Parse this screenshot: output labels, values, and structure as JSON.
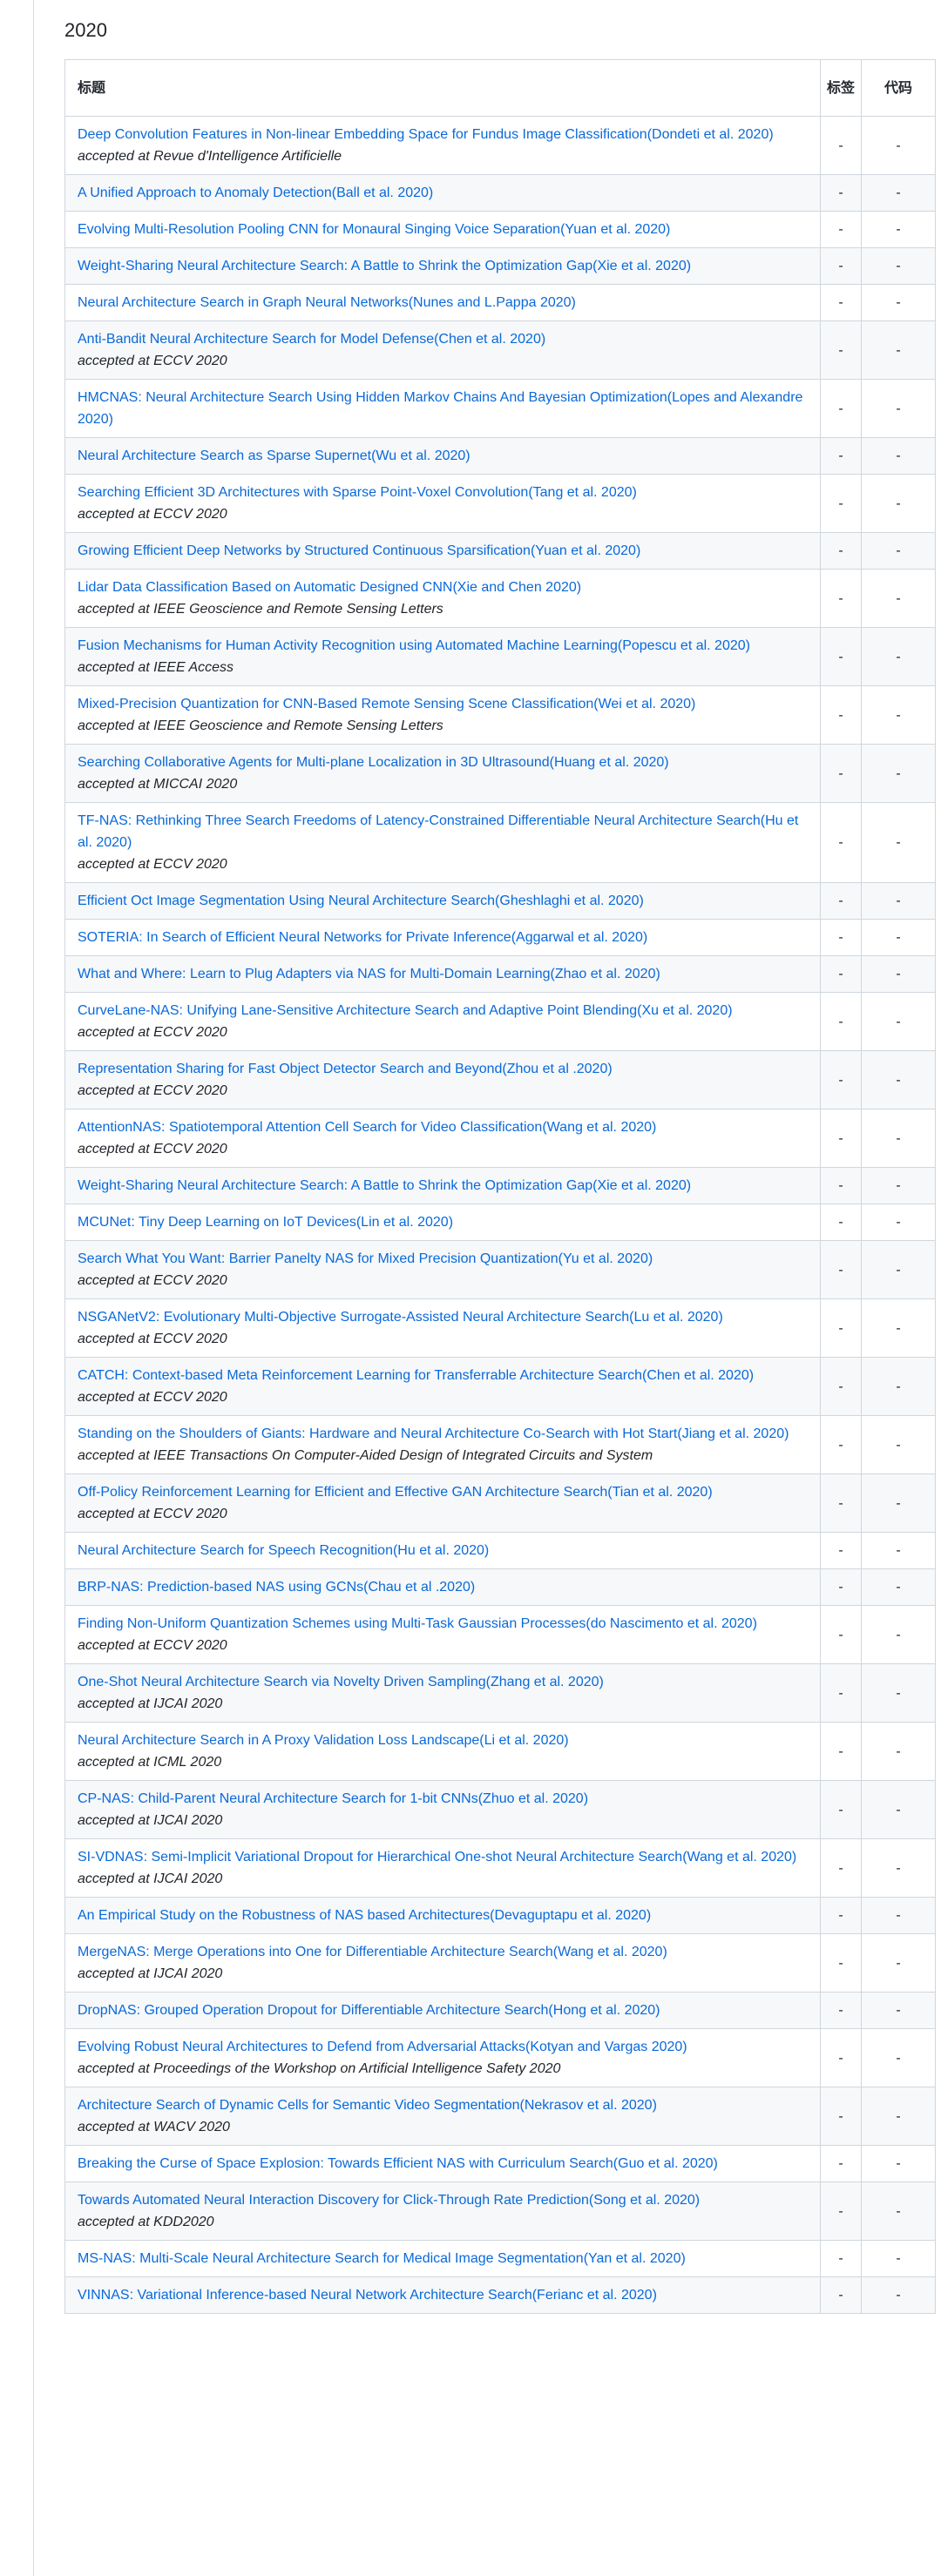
{
  "section": {
    "heading": "2020"
  },
  "table": {
    "headers": {
      "title": "标题",
      "tags": "标签",
      "code": "代码"
    },
    "rows": [
      {
        "title": "Deep Convolution Features in Non-linear Embedding Space for Fundus Image Classification(Dondeti et al. 2020)",
        "note": "accepted at Revue d'Intelligence Artificielle",
        "tags": "-",
        "code": "-"
      },
      {
        "title": "A Unified Approach to Anomaly Detection(Ball et al. 2020)",
        "note": "",
        "tags": "-",
        "code": "-"
      },
      {
        "title": "Evolving Multi-Resolution Pooling CNN for Monaural Singing Voice Separation(Yuan et al. 2020)",
        "note": "",
        "tags": "-",
        "code": "-"
      },
      {
        "title": "Weight-Sharing Neural Architecture Search: A Battle to Shrink the Optimization Gap(Xie et al. 2020)",
        "note": "",
        "tags": "-",
        "code": "-"
      },
      {
        "title": "Neural Architecture Search in Graph Neural Networks(Nunes and L.Pappa 2020)",
        "note": "",
        "tags": "-",
        "code": "-"
      },
      {
        "title": "Anti-Bandit Neural Architecture Search for Model Defense(Chen et al. 2020)",
        "note": "accepted at ECCV 2020",
        "tags": "-",
        "code": "-"
      },
      {
        "title": "HMCNAS: Neural Architecture Search Using Hidden Markov Chains And Bayesian Optimization(Lopes and Alexandre 2020)",
        "note": "",
        "tags": "-",
        "code": "-"
      },
      {
        "title": "Neural Architecture Search as Sparse Supernet(Wu et al. 2020)",
        "note": "",
        "tags": "-",
        "code": "-"
      },
      {
        "title": "Searching Efficient 3D Architectures with Sparse Point-Voxel Convolution(Tang et al. 2020)",
        "note": "accepted at ECCV 2020",
        "tags": "-",
        "code": "-"
      },
      {
        "title": "Growing Efficient Deep Networks by Structured Continuous Sparsification(Yuan et al. 2020)",
        "note": "",
        "tags": "-",
        "code": "-"
      },
      {
        "title": "Lidar Data Classification Based on Automatic Designed CNN(Xie and Chen 2020)",
        "note": "accepted at IEEE Geoscience and Remote Sensing Letters",
        "tags": "-",
        "code": "-"
      },
      {
        "title": "Fusion Mechanisms for Human Activity Recognition using Automated Machine Learning(Popescu et al. 2020)",
        "note": "accepted at IEEE Access",
        "tags": "-",
        "code": "-"
      },
      {
        "title": "Mixed-Precision Quantization for CNN-Based Remote Sensing Scene Classification(Wei et al. 2020)",
        "note": "accepted at IEEE Geoscience and Remote Sensing Letters",
        "tags": "-",
        "code": "-"
      },
      {
        "title": "Searching Collaborative Agents for Multi-plane Localization in 3D Ultrasound(Huang et al. 2020)",
        "note": "accepted at MICCAI 2020",
        "tags": "-",
        "code": "-"
      },
      {
        "title": "TF-NAS: Rethinking Three Search Freedoms of Latency-Constrained Differentiable Neural Architecture Search(Hu et al. 2020)",
        "note": "accepted at ECCV 2020",
        "tags": "-",
        "code": "-"
      },
      {
        "title": "Efficient Oct Image Segmentation Using Neural Architecture Search(Gheshlaghi et al. 2020)",
        "note": "",
        "tags": "-",
        "code": "-"
      },
      {
        "title": "SOTERIA: In Search of Efficient Neural Networks for Private Inference(Aggarwal et al. 2020)",
        "note": "",
        "tags": "-",
        "code": "-"
      },
      {
        "title": "What and Where: Learn to Plug Adapters via NAS for Multi-Domain Learning(Zhao et al. 2020)",
        "note": "",
        "tags": "-",
        "code": "-"
      },
      {
        "title": "CurveLane-NAS: Unifying Lane-Sensitive Architecture Search and Adaptive Point Blending(Xu et al. 2020)",
        "note": "accepted at ECCV 2020",
        "tags": "-",
        "code": "-"
      },
      {
        "title": "Representation Sharing for Fast Object Detector Search and Beyond(Zhou et al .2020)",
        "note": "accepted at ECCV 2020",
        "tags": "-",
        "code": "-"
      },
      {
        "title": "AttentionNAS: Spatiotemporal Attention Cell Search for Video Classification(Wang et al. 2020)",
        "note": "accepted at ECCV 2020",
        "tags": "-",
        "code": "-"
      },
      {
        "title": "Weight-Sharing Neural Architecture Search: A Battle to Shrink the Optimization Gap(Xie et al. 2020)",
        "note": "",
        "tags": "-",
        "code": "-"
      },
      {
        "title": "MCUNet: Tiny Deep Learning on IoT Devices(Lin et al. 2020)",
        "note": "",
        "tags": "-",
        "code": "-"
      },
      {
        "title": "Search What You Want: Barrier Panelty NAS for Mixed Precision Quantization(Yu et al. 2020)",
        "note": "accepted at ECCV 2020",
        "tags": "-",
        "code": "-"
      },
      {
        "title": "NSGANetV2: Evolutionary Multi-Objective Surrogate-Assisted Neural Architecture Search(Lu et al. 2020)",
        "note": "accepted at ECCV 2020",
        "tags": "-",
        "code": "-"
      },
      {
        "title": "CATCH: Context-based Meta Reinforcement Learning for Transferrable Architecture Search(Chen et al. 2020)",
        "note": "accepted at ECCV 2020",
        "tags": "-",
        "code": "-"
      },
      {
        "title": "Standing on the Shoulders of Giants: Hardware and Neural Architecture Co-Search with Hot Start(Jiang et al. 2020)",
        "note": "accepted at IEEE Transactions On Computer-Aided Design of Integrated Circuits and System",
        "tags": "-",
        "code": "-"
      },
      {
        "title": "Off-Policy Reinforcement Learning for Efficient and Effective GAN Architecture Search(Tian et al. 2020)",
        "note": "accepted at ECCV 2020",
        "tags": "-",
        "code": "-"
      },
      {
        "title": "Neural Architecture Search for Speech Recognition(Hu et al. 2020)",
        "note": "",
        "tags": "-",
        "code": "-"
      },
      {
        "title": "BRP-NAS: Prediction-based NAS using GCNs(Chau et al .2020)",
        "note": "",
        "tags": "-",
        "code": "-"
      },
      {
        "title": "Finding Non-Uniform Quantization Schemes using Multi-Task Gaussian Processes(do Nascimento et al. 2020)",
        "note": "accepted at ECCV 2020",
        "tags": "-",
        "code": "-"
      },
      {
        "title": "One-Shot Neural Architecture Search via Novelty Driven Sampling(Zhang et al. 2020)",
        "note": "accepted at IJCAI 2020",
        "tags": "-",
        "code": "-"
      },
      {
        "title": "Neural Architecture Search in A Proxy Validation Loss Landscape(Li et al. 2020)",
        "note": "accepted at ICML 2020",
        "tags": "-",
        "code": "-"
      },
      {
        "title": "CP-NAS: Child-Parent Neural Architecture Search for 1-bit CNNs(Zhuo et al. 2020)",
        "note": "accepted at IJCAI 2020",
        "tags": "-",
        "code": "-"
      },
      {
        "title": "SI-VDNAS: Semi-Implicit Variational Dropout for Hierarchical One-shot Neural Architecture Search(Wang et al. 2020)",
        "note": "accepted at IJCAI 2020",
        "tags": "-",
        "code": "-"
      },
      {
        "title": "An Empirical Study on the Robustness of NAS based Architectures(Devaguptapu et al. 2020)",
        "note": "",
        "tags": "-",
        "code": "-"
      },
      {
        "title": "MergeNAS: Merge Operations into One for Differentiable Architecture Search(Wang et al. 2020)",
        "note": "accepted at IJCAI 2020",
        "tags": "-",
        "code": "-"
      },
      {
        "title": "DropNAS: Grouped Operation Dropout for Differentiable Architecture Search(Hong et al. 2020)",
        "note": "",
        "tags": "-",
        "code": "-"
      },
      {
        "title": "Evolving Robust Neural Architectures to Defend from Adversarial Attacks(Kotyan and Vargas 2020)",
        "note": "accepted at Proceedings of the Workshop on Artificial Intelligence Safety 2020",
        "tags": "-",
        "code": "-"
      },
      {
        "title": "Architecture Search of Dynamic Cells for Semantic Video Segmentation(Nekrasov et al. 2020)",
        "note": "accepted at WACV 2020",
        "tags": "-",
        "code": "-"
      },
      {
        "title": "Breaking the Curse of Space Explosion: Towards Efficient NAS with Curriculum Search(Guo et al. 2020)",
        "note": "",
        "tags": "-",
        "code": "-"
      },
      {
        "title": "Towards Automated Neural Interaction Discovery for Click-Through Rate Prediction(Song et al. 2020)",
        "note": "accepted at KDD2020",
        "tags": "-",
        "code": "-"
      },
      {
        "title": "MS-NAS: Multi-Scale Neural Architecture Search for Medical Image Segmentation(Yan et al. 2020)",
        "note": "",
        "tags": "-",
        "code": "-"
      },
      {
        "title": "VINNAS: Variational Inference-based Neural Network Architecture Search(Ferianc et al. 2020)",
        "note": "",
        "tags": "-",
        "code": "-"
      }
    ]
  }
}
